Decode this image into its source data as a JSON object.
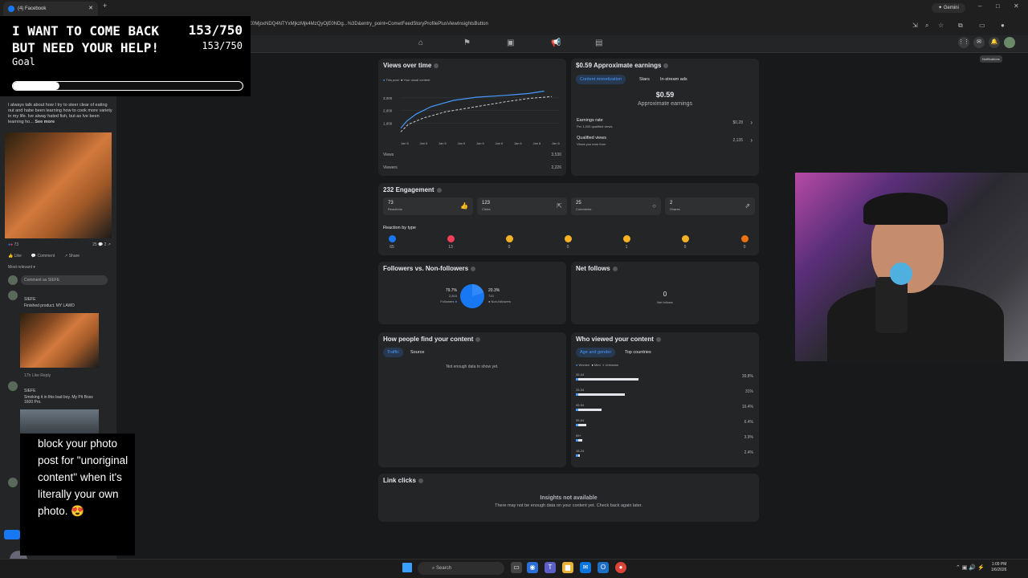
{
  "browser": {
    "tab_title": "(4) Facebook",
    "url": "E0MjoxNDQ4NTYxMjkzMjk4MzQyOjE0NDg1NjEyOTMyNDI5Mjg1NDE0MTYwNDE0MTYwOjE0NDg1NjEyOTIyOTk0ODY5NjM3MjQ5NjE0MDk2MjE2NjQ6MDpqYz0xOn0%3D&entry_point=CometFeedStoryProfilePlusViewInsightsButton",
    "url_display": "E0MjoxNDQ4NTYxMjkzMjk4MzQyOjE0NDg...%3D&entry_point=CometFeedStoryProfilePlusViewInsightsButton",
    "gemini_label": "Gemini",
    "tooltip": "Notifications"
  },
  "goal_overlay": {
    "line1": "I WANT TO COME BACK",
    "line2": "BUT NEED YOUR HELP!",
    "count_big": "153/750",
    "count_small": "153/750",
    "label": "Goal",
    "progress": 0.204
  },
  "post": {
    "text": "I always talk about how I try to steer clear of eating out and habe been learning how to cook more variety in my life. Ive alway hated fish, but as Ive been learning ho...",
    "see_more": "See more",
    "reactions_count": "73",
    "comments_shares": "25 💬 2 ↗",
    "like": "Like",
    "comment": "Comment",
    "share": "Share",
    "most_relevant": "Most relevant ▾",
    "comment_placeholder": "Comment as SIEFE",
    "c1_name": "SIEFE",
    "c1_text": "Finished product. MY LAWD",
    "c1_meta": "17h   Like   Reply",
    "c2_name": "SIEFE",
    "c2_text": "Smoking it in this bad boy. My Pit Boss 1600 Pro.",
    "subtitle": "block your photo post for \"unoriginal content\" when it's literally your own photo. 😍"
  },
  "views_over_time": {
    "title": "Views over time",
    "legend_this": "This post",
    "legend_usual": "Your usual content",
    "y_ticks": [
      "3,000",
      "2,000",
      "1,000"
    ],
    "x_ticks": [
      "Jan 5",
      "Jan 5",
      "Jan 5",
      "Jan 6",
      "Jan 6",
      "Jan 6",
      "Jan 6",
      "Jan 6",
      "Jan 6"
    ],
    "views_label": "Views",
    "views_value": "3,530",
    "viewers_label": "Viewers",
    "viewers_value": "2,226"
  },
  "earnings": {
    "title": "$0.59 Approximate earnings",
    "tabs": [
      "Content monetization",
      "Stars",
      "In-stream ads"
    ],
    "amount": "$0.59",
    "amount_label": "Approximate earnings",
    "rate_label": "Earnings rate",
    "rate_sub": "Per 1,000 qualified views",
    "rate_value": "$0.28",
    "qv_label": "Qualified views",
    "qv_sub": "Views you earn from",
    "qv_value": "2,135"
  },
  "engagement": {
    "title": "232 Engagement",
    "boxes": [
      {
        "value": "73",
        "label": "Reactions"
      },
      {
        "value": "123",
        "label": "Clicks"
      },
      {
        "value": "25",
        "label": "Comments"
      },
      {
        "value": "2",
        "label": "Shares"
      }
    ],
    "reaction_title": "Reaction by type",
    "reactions": [
      {
        "icon": "like-icon",
        "color": "#1877f2",
        "count": "65"
      },
      {
        "icon": "love-icon",
        "color": "#f33e58",
        "count": "13"
      },
      {
        "icon": "care-icon",
        "color": "#f7b125",
        "count": "0"
      },
      {
        "icon": "haha-icon",
        "color": "#f7b125",
        "count": "0"
      },
      {
        "icon": "wow-icon",
        "color": "#f7b125",
        "count": "1"
      },
      {
        "icon": "sad-icon",
        "color": "#f7b125",
        "count": "0"
      },
      {
        "icon": "angry-icon",
        "color": "#e9710f",
        "count": "0"
      }
    ]
  },
  "followers": {
    "title": "Followers vs. Non-followers",
    "followers_pct": "79.7%",
    "followers_count": "2,815",
    "followers_label": "Followers",
    "non_pct": "20.3%",
    "non_count": "715",
    "non_label": "Non-followers"
  },
  "net_follows": {
    "title": "Net follows",
    "value": "0",
    "label": "Net follows"
  },
  "find_content": {
    "title": "How people find your content",
    "tabs": [
      "Traffic",
      "Source"
    ],
    "empty": "Not enough data to show yet."
  },
  "who_viewed": {
    "title": "Who viewed your content",
    "tabs": [
      "Age and gender",
      "Top countries"
    ],
    "legend": [
      "Women",
      "Men",
      "Unknown"
    ],
    "rows": [
      {
        "age": "35-44",
        "pct": "39.8%",
        "value": 39.8
      },
      {
        "age": "25-34",
        "pct": "31%",
        "value": 31
      },
      {
        "age": "45-54",
        "pct": "16.4%",
        "value": 16.4
      },
      {
        "age": "55-64",
        "pct": "6.4%",
        "value": 6.4
      },
      {
        "age": "65+",
        "pct": "3.9%",
        "value": 3.9
      },
      {
        "age": "18-24",
        "pct": "2.4%",
        "value": 2.4
      }
    ]
  },
  "link_clicks": {
    "title": "Link clicks",
    "heading": "Insights not available",
    "body": "There may not be enough data on your content yet. Check back again later."
  },
  "taskbar": {
    "search": "Search",
    "time": "1:09 PM",
    "date": "1/6/2026"
  },
  "colors": {
    "accent": "#4599ff",
    "card": "#242526",
    "bg": "#18191a"
  }
}
